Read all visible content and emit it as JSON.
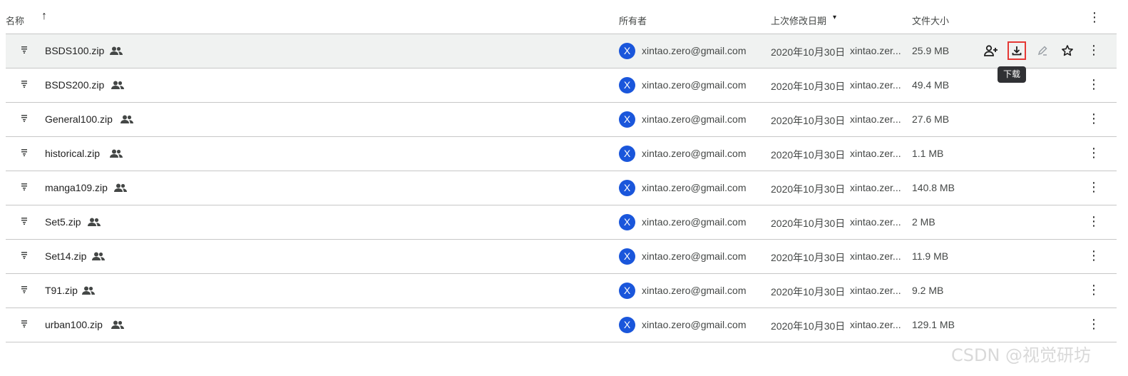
{
  "columns": {
    "name": "名称",
    "sort_arrow": "↑",
    "owner": "所有者",
    "modified": "上次修改日期",
    "modified_caret": "▾",
    "size": "文件大小",
    "more": "⋮"
  },
  "files": [
    {
      "name": "BSDS100.zip",
      "owner_initial": "X",
      "owner": "xintao.zero@gmail.com",
      "date": "2020年10月30日",
      "modified_by": "xintao.zer...",
      "size": "25.9 MB"
    },
    {
      "name": "BSDS200.zip",
      "owner_initial": "X",
      "owner": "xintao.zero@gmail.com",
      "date": "2020年10月30日",
      "modified_by": "xintao.zer...",
      "size": "49.4 MB"
    },
    {
      "name": "General100.zip",
      "owner_initial": "X",
      "owner": "xintao.zero@gmail.com",
      "date": "2020年10月30日",
      "modified_by": "xintao.zer...",
      "size": "27.6 MB"
    },
    {
      "name": "historical.zip",
      "owner_initial": "X",
      "owner": "xintao.zero@gmail.com",
      "date": "2020年10月30日",
      "modified_by": "xintao.zer...",
      "size": "1.1 MB"
    },
    {
      "name": "manga109.zip",
      "owner_initial": "X",
      "owner": "xintao.zero@gmail.com",
      "date": "2020年10月30日",
      "modified_by": "xintao.zer...",
      "size": "140.8 MB"
    },
    {
      "name": "Set5.zip",
      "owner_initial": "X",
      "owner": "xintao.zero@gmail.com",
      "date": "2020年10月30日",
      "modified_by": "xintao.zer...",
      "size": "2 MB"
    },
    {
      "name": "Set14.zip",
      "owner_initial": "X",
      "owner": "xintao.zero@gmail.com",
      "date": "2020年10月30日",
      "modified_by": "xintao.zer...",
      "size": "11.9 MB"
    },
    {
      "name": "T91.zip",
      "owner_initial": "X",
      "owner": "xintao.zero@gmail.com",
      "date": "2020年10月30日",
      "modified_by": "xintao.zer...",
      "size": "9.2 MB"
    },
    {
      "name": "urban100.zip",
      "owner_initial": "X",
      "owner": "xintao.zero@gmail.com",
      "date": "2020年10月30日",
      "modified_by": "xintao.zer...",
      "size": "129.1 MB"
    }
  ],
  "row_more": "⋮",
  "tooltip": "下载",
  "watermark": "CSDN @视觉研坊",
  "colors": {
    "avatar": "#1a56db",
    "hover_row": "#f0f2f1",
    "highlight_box": "#e53935",
    "tooltip_bg": "#303134"
  },
  "icons": {
    "file": "zip-file-icon",
    "shared": "shared-people-icon",
    "share_action": "add-person-icon",
    "download_action": "download-icon",
    "rename_action": "pencil-icon",
    "star_action": "star-icon"
  },
  "hovered_row": 0
}
